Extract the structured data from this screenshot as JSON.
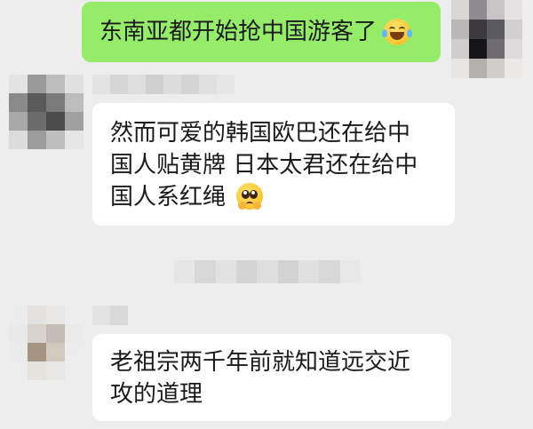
{
  "chat": {
    "messages": [
      {
        "direction": "sent",
        "lines": [
          "东南亚都开始抢中国游客了"
        ],
        "emoji": "face-with-tears-of-joy-icon"
      },
      {
        "direction": "received",
        "lines": [
          "然而可爱的韩国欧巴还在给中",
          "国人贴黄牌 日本太君还在给中",
          "国人系红绳"
        ],
        "emoji": "pleading-face-icon"
      },
      {
        "direction": "received",
        "lines": [
          "老祖宗两千年前就知道远交近",
          "攻的道理"
        ]
      }
    ]
  },
  "colors": {
    "background": "#ededed",
    "sent_bubble": "#95ec69",
    "received_bubble": "#ffffff"
  }
}
